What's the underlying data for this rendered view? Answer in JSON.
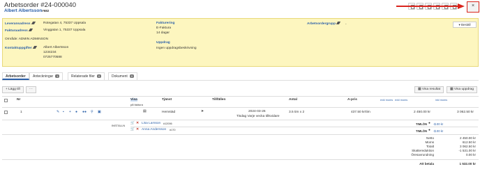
{
  "header": {
    "title": "Arbetsorder #24-000040",
    "customer_name": "Albert Albertsson",
    "customer_id": "#682",
    "close_label": "×"
  },
  "info": {
    "leveransadress_label": "Leveransadress",
    "leveransadress_value": "Rotegatan 4, 75337 Uppsala",
    "fakturaadress_label": "Fakturaadress",
    "fakturaadress_value": "Vinggatan 1, 75337 Uppsala",
    "omrade": "Område: ADMIN ADMINSON",
    "kontakt_label": "Kontaktuppgifter",
    "kontakt_name": "Albert Albertsson",
    "kontakt_phone1": "1234234",
    "kontakt_phone2": "0725770588",
    "fakturering_label": "Fakturering",
    "fakturering_value1": "E-Faktura",
    "fakturering_value2": "14 dagar",
    "uppdrag_label": "Uppdrag",
    "uppdrag_value": "Ingen uppdragsbeskrivning",
    "grupp_label": "Arbetsordergrupp",
    "grupp_value": "-",
    "bestall_label": "▾ Beställ"
  },
  "tabs": [
    {
      "label": "Arbetsorder",
      "badge": ""
    },
    {
      "label": "Anteckningar",
      "badge": "1"
    },
    {
      "label": "Relaterade filer",
      "badge": "0"
    },
    {
      "label": "Dokument",
      "badge": "0"
    }
  ],
  "toolbar": {
    "add_label": "+ Lägg till",
    "more_label": "···",
    "show_result_label": "Visa resultat",
    "show_task_label": "Visa uppdrag"
  },
  "table": {
    "headers": {
      "nr": "Nr",
      "visa": "Visa",
      "visa_sub": "på faktura",
      "tjanst": "Tjänst",
      "tillfallen": "Tillfällen",
      "antal": "Antal",
      "apris": "A-pris",
      "apris_sub": "exkl moms",
      "col_a_sub": "exkl moms",
      "col_b_sub": "inkl moms"
    },
    "row": {
      "nr": "1",
      "tjanst": "Hemstäd",
      "date": "2024-03-26",
      "schedule": "Tisdag Varje vecka tillsvidare",
      "antal": "3.5 tim x 2",
      "apris": "437.50 kr/tim",
      "exkl": "2 450.00 kr",
      "inkl": "3 062.50 kr"
    },
    "staff_label": "INSTÄLLN",
    "staff": [
      {
        "name": "Lisa Larsson",
        "id": "#12006",
        "timlon_label": "TIMLÖN",
        "timlon_value": "-$.00 kr"
      },
      {
        "name": "Anna Andersson",
        "id": "#170",
        "timlon_label": "TIMLÖN",
        "timlon_value": "-$.00 kr"
      }
    ]
  },
  "totals": [
    {
      "label": "Netto",
      "value": "2 450.00 kr"
    },
    {
      "label": "Moms",
      "value": "612.50 kr"
    },
    {
      "label": "Totalt",
      "value": "3 062.50 kr"
    },
    {
      "label": "Skattereduktion",
      "value": "-1 531.00 kr"
    },
    {
      "label": "Öresavrundning",
      "value": "0.00 kr"
    }
  ],
  "att_betala": {
    "label": "Att betala",
    "value": "1 532.00 kr"
  },
  "colors": {
    "accent": "#2a5fa8",
    "panel": "#fdf6bf",
    "annotation": "#d9241c"
  }
}
